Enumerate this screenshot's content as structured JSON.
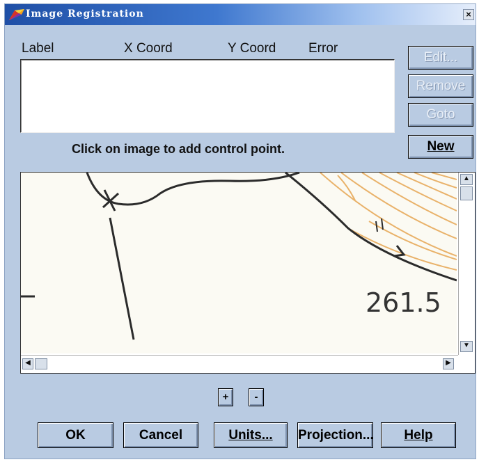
{
  "window": {
    "title": "Image Registration",
    "close_label": "×"
  },
  "columns": [
    "Label",
    "X Coord",
    "Y Coord",
    "Error"
  ],
  "side_buttons": {
    "edit": "Edit...",
    "remove": "Remove",
    "goto": "Goto",
    "new": "New"
  },
  "hint": "Click on image to add control point.",
  "image": {
    "elevation_label": "261.5",
    "mark_label": "11"
  },
  "scroll": {
    "up": "▲",
    "down": "▼",
    "left": "◀",
    "right": "▶"
  },
  "zoom": {
    "in": "+",
    "out": "-"
  },
  "bottom_buttons": {
    "ok": "OK",
    "cancel": "Cancel",
    "units": "Units...",
    "projection": "Projection...",
    "help": "Help"
  }
}
